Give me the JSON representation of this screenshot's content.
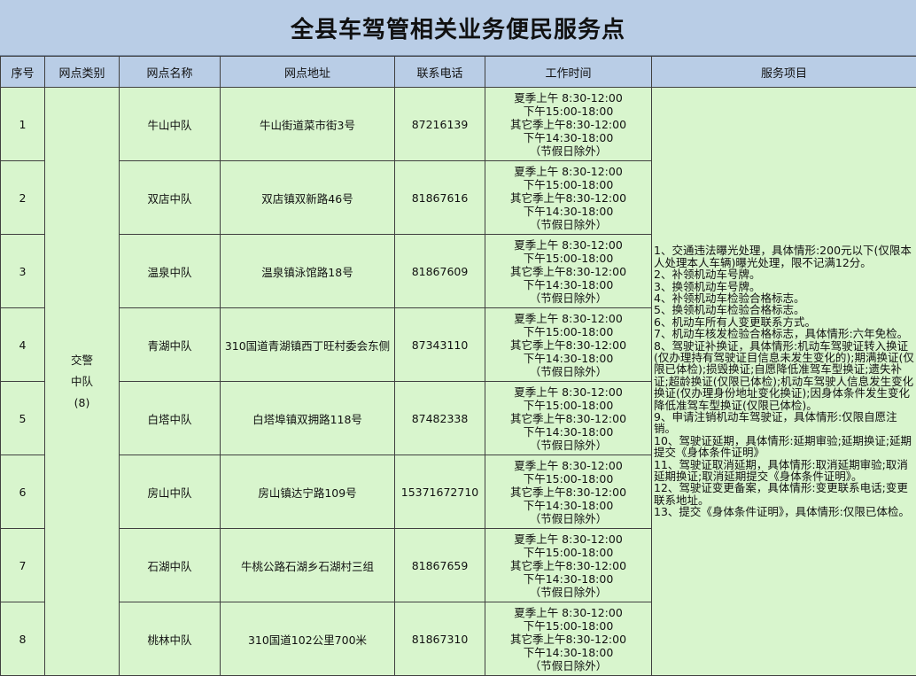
{
  "title": "全县车驾管相关业务便民服务点",
  "headers": [
    "序号",
    "网点类别",
    "网点名称",
    "网点地址",
    "联系电话",
    "工作时间",
    "服务项目"
  ],
  "category": {
    "text": "交警中队",
    "count": "(8)"
  },
  "hours": [
    "夏季上午 8:30-12:00",
    "下午15:00-18:00",
    "其它季上午8:30-12:00",
    "下午14:30-18:00",
    "（节假日除外）"
  ],
  "rows": [
    {
      "no": "1",
      "name": "牛山中队",
      "address": "牛山街道菜市街3号",
      "phone": "87216139"
    },
    {
      "no": "2",
      "name": "双店中队",
      "address": "双店镇双新路46号",
      "phone": "81867616"
    },
    {
      "no": "3",
      "name": "温泉中队",
      "address": "温泉镇泳馆路18号",
      "phone": "81867609"
    },
    {
      "no": "4",
      "name": "青湖中队",
      "address": "310国道青湖镇西丁旺村委会东侧",
      "phone": "87343110"
    },
    {
      "no": "5",
      "name": "白塔中队",
      "address": "白塔埠镇双拥路118号",
      "phone": "87482338"
    },
    {
      "no": "6",
      "name": "房山中队",
      "address": "房山镇达宁路109号",
      "phone": "15371672710"
    },
    {
      "no": "7",
      "name": "石湖中队",
      "address": "牛桃公路石湖乡石湖村三组",
      "phone": "81867659"
    },
    {
      "no": "8",
      "name": "桃林中队",
      "address": "310国道102公里700米",
      "phone": "81867310"
    }
  ],
  "services": [
    "1、交通违法曝光处理，具体情形:200元以下(仅限本人处理本人车辆)曝光处理，限不记满12分。",
    "2、补领机动车号牌。",
    "3、换领机动车号牌。",
    "4、补领机动车检验合格标志。",
    "5、换领机动车检验合格标志。",
    "6、机动车所有人变更联系方式。",
    "7、机动车核发检验合格标志，具体情形:六年免检。",
    "8、驾驶证补换证，具体情形:机动车驾驶证转入换证(仅办理持有驾驶证目信息未发生变化的);期满换证(仅限已体检);损毁换证;自愿降低准驾车型换证;遗失补证;超龄换证(仅限已体检);机动车驾驶人信息发生变化换证(仅办理身份地址变化换证);因身体条件发生变化降低准驾车型换证(仅限已体检)。",
    "9、申请注销机动车驾驶证，具体情形:仅限自愿注销。",
    "10、驾驶证延期，具体情形:延期审验;延期换证;延期提交《身体条件证明》",
    "11、驾驶证取消延期，具体情形:取消延期审验;取消延期换证;取消延期提交《身体条件证明》。",
    "12、驾驶证变更备案，具体情形:变更联系电话;变更联系地址。",
    "13、提交《身体条件证明》，具体情形:仅限已体检。"
  ]
}
